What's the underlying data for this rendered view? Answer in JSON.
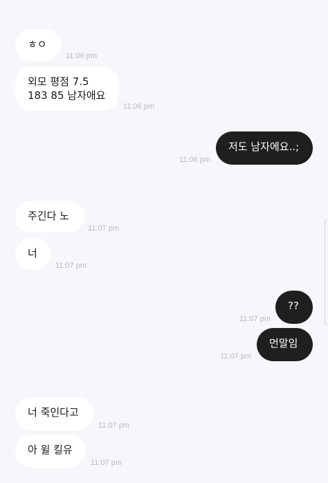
{
  "messages": [
    {
      "direction": "incoming",
      "text": "ㅎㅇ",
      "time": "11:06 pm"
    },
    {
      "direction": "incoming",
      "text": "외모 평점 7.5\n183 85 남자애요",
      "time": "11:06 pm"
    },
    {
      "direction": "outgoing",
      "text": "저도 남자에요..;",
      "time": "11:06 pm"
    },
    {
      "direction": "incoming",
      "text": "주긴다 노",
      "time": "11:07 pm"
    },
    {
      "direction": "incoming",
      "text": "너",
      "time": "11:07 pm"
    },
    {
      "direction": "outgoing",
      "text": "??",
      "time": "11:07 pm"
    },
    {
      "direction": "outgoing",
      "text": "먼말임",
      "time": "11:07 pm"
    },
    {
      "direction": "incoming",
      "text": "너 죽인다고",
      "time": "11:07 pm"
    },
    {
      "direction": "incoming",
      "text": "아 윌 킬유",
      "time": "11:07 pm"
    }
  ],
  "colors": {
    "background": "#f6f6fb",
    "incoming_bubble": "#ffffff",
    "outgoing_bubble": "#1f1f1f",
    "timestamp": "#b9b9c1"
  }
}
